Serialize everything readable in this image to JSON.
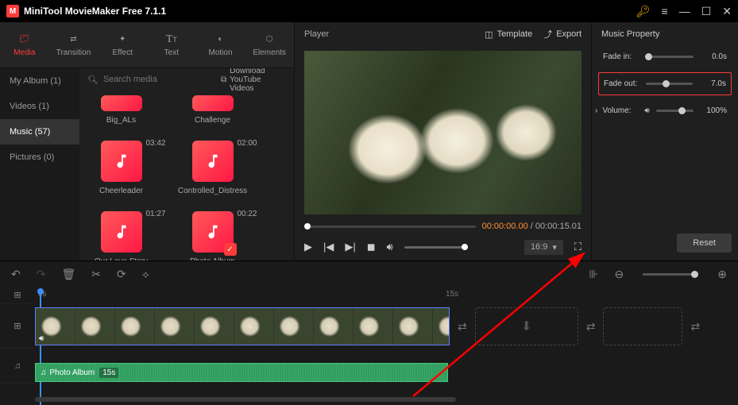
{
  "app": {
    "title": "MiniTool MovieMaker Free 7.1.1"
  },
  "toolbar": [
    {
      "label": "Media",
      "active": true
    },
    {
      "label": "Transition"
    },
    {
      "label": "Effect"
    },
    {
      "label": "Text"
    },
    {
      "label": "Motion"
    },
    {
      "label": "Elements"
    }
  ],
  "sidebar": [
    {
      "label": "My Album (1)"
    },
    {
      "label": "Videos (1)"
    },
    {
      "label": "Music (57)",
      "active": true
    },
    {
      "label": "Pictures (0)"
    }
  ],
  "search": {
    "placeholder": "Search media"
  },
  "download_btn": "Download YouTube Videos",
  "media_items": [
    {
      "name": "Big_ALs",
      "short": true
    },
    {
      "name": "Challenge",
      "short": true
    },
    {
      "name": "Cheerleader",
      "duration": "03:42"
    },
    {
      "name": "Controlled_Distress",
      "duration": "02:00"
    },
    {
      "name": "Our Love Story",
      "duration": "01:27"
    },
    {
      "name": "Photo Album",
      "duration": "00:22",
      "checked": true
    }
  ],
  "player": {
    "title": "Player",
    "template_btn": "Template",
    "export_btn": "Export",
    "current_time": "00:00:00.00",
    "total_time": "00:00:15.01",
    "aspect": "16:9"
  },
  "props": {
    "title": "Music Property",
    "fade_in": {
      "label": "Fade in:",
      "value": "0.0s",
      "pos": 0
    },
    "fade_out": {
      "label": "Fade out:",
      "value": "7.0s",
      "pos": 35
    },
    "volume": {
      "label": "Volume:",
      "value": "100%",
      "pos": 60
    },
    "reset": "Reset"
  },
  "timeline": {
    "start": "0s",
    "mid": "15s",
    "music_clip": {
      "name": "Photo Album",
      "length": "15s"
    }
  }
}
